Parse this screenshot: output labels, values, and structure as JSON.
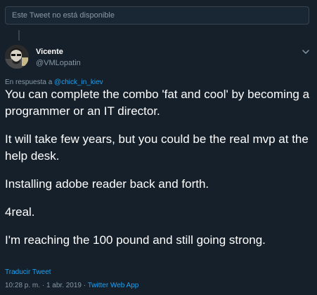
{
  "unavailable_notice": "Este Tweet no está disponible",
  "author": {
    "display_name": "Vicente",
    "handle": "@VMLopatin"
  },
  "reply": {
    "prefix": "En respuesta a",
    "mention": "@chick_in_kiev"
  },
  "tweet": {
    "paragraphs": [
      "You can complete the combo 'fat and cool' by becoming a programmer or an IT director.",
      "It will take few years, but you could be the real mvp at the help desk.",
      "Installing adobe reader back and forth.",
      "4real.",
      "I'm reaching the 100 pound and still going strong."
    ]
  },
  "translate_label": "Traducir Tweet",
  "meta": {
    "time": "10:28 p. m.",
    "separator1": "·",
    "date": "1 abr. 2019",
    "separator2": "·",
    "app": "Twitter Web App"
  },
  "colors": {
    "background": "#15202b",
    "text_primary": "#ffffff",
    "text_secondary": "#8899a6",
    "link": "#1da1f2",
    "border": "#38444d"
  },
  "icons": {
    "menu": "chevron-down-icon",
    "avatar": "avatar-image"
  }
}
